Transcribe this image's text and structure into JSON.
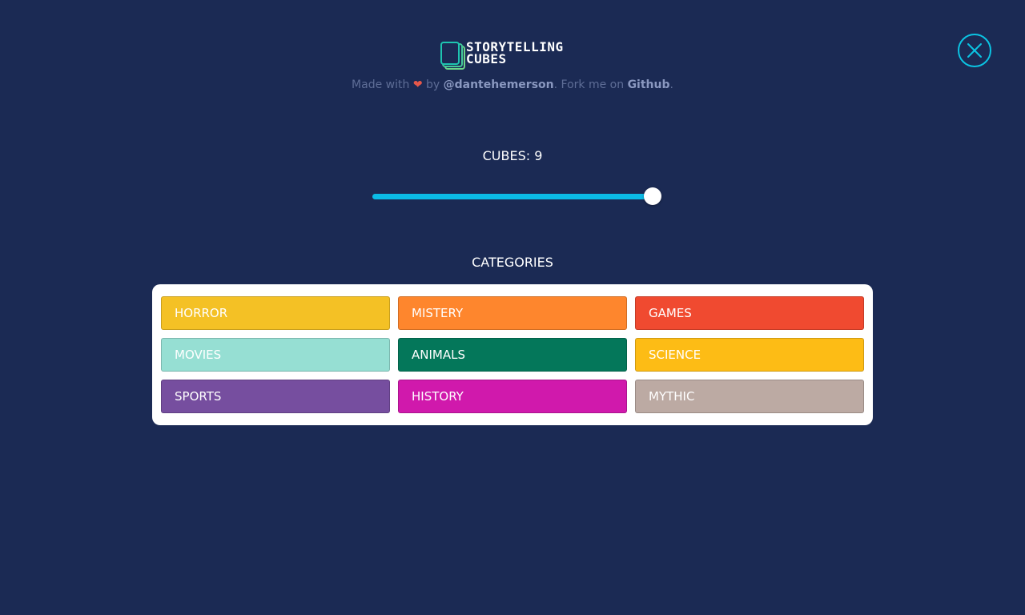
{
  "logo": {
    "line1": "STORYTELLING",
    "line2": "CUBES"
  },
  "credits": {
    "made_with": "Made with",
    "heart": "❤",
    "by": "by",
    "author": "@dantehemerson",
    "fork_text": ". Fork me on",
    "github": "Github",
    "period": "."
  },
  "close_icon": "close-icon",
  "cubes": {
    "label": "CUBES: 9",
    "value": 9,
    "min": 1,
    "max": 9,
    "fill_color": "#0bbbe6"
  },
  "categories": {
    "title": "CATEGORIES",
    "items": [
      {
        "label": "HORROR",
        "color": "#f4c125"
      },
      {
        "label": "MISTERY",
        "color": "#fe862d"
      },
      {
        "label": "GAMES",
        "color": "#f04a30"
      },
      {
        "label": "MOVIES",
        "color": "#96dfd3"
      },
      {
        "label": "ANIMALS",
        "color": "#04775a"
      },
      {
        "label": "SCIENCE",
        "color": "#fdbc15"
      },
      {
        "label": "SPORTS",
        "color": "#764e9f"
      },
      {
        "label": "HISTORY",
        "color": "#d019ac"
      },
      {
        "label": "MYTHIC",
        "color": "#bcaaa3"
      }
    ]
  },
  "colors": {
    "background": "#1b2a54",
    "accent": "#0bc4e3"
  }
}
